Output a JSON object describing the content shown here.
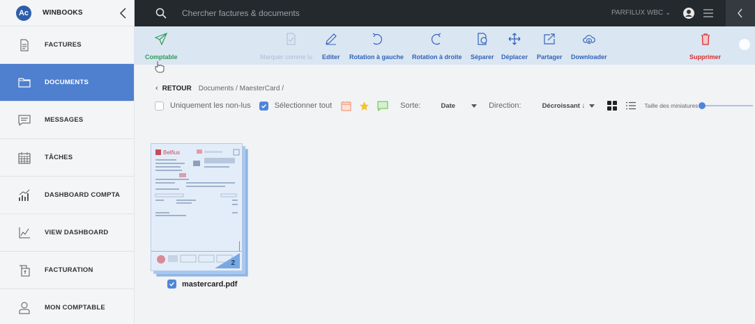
{
  "app": {
    "logo_text": "Ac",
    "title": "WINBOOKS"
  },
  "sidebar": {
    "items": [
      {
        "label": "FACTURES",
        "icon": "invoice-icon"
      },
      {
        "label": "DOCUMENTS",
        "icon": "folder-icon",
        "active": true
      },
      {
        "label": "MESSAGES",
        "icon": "message-icon"
      },
      {
        "label": "TÂCHES",
        "icon": "calendar-icon"
      },
      {
        "label": "DASHBOARD COMPTA",
        "icon": "chart-icon"
      },
      {
        "label": "VIEW DASHBOARD",
        "icon": "line-chart-icon"
      },
      {
        "label": "FACTURATION",
        "icon": "billing-icon"
      },
      {
        "label": "MON COMPTABLE",
        "icon": "user-icon"
      }
    ]
  },
  "topbar": {
    "search_placeholder": "Chercher factures & documents",
    "user_label": "PARFILUX WBC"
  },
  "toolbar": {
    "comptable": "Comptable",
    "marquer": "Marquer comme lu",
    "editer": "Editer",
    "rot_gauche": "Rotation à gauche",
    "rot_droite": "Rotation à droite",
    "separer": "Séparer",
    "deplacer": "Déplacer",
    "partager": "Partager",
    "downloader": "Downloader",
    "supprimer": "Supprimer"
  },
  "breadcrumb": {
    "back": "RETOUR",
    "path": "Documents / MaesterCard /"
  },
  "filters": {
    "non_lus": "Uniquement les non-lus",
    "select_all": "Sélectionner tout",
    "sort_label": "Sorte:",
    "sort_value": "Date",
    "direction_label": "Direction:",
    "direction_value": "Décroissant ↓",
    "thumb_size_label": "Taille des miniatures"
  },
  "document": {
    "file_name": "mastercard.pdf",
    "page_count": "2",
    "brand": "Belfius"
  },
  "colors": {
    "accent": "#4f7fcf",
    "topbar": "#24292d",
    "toolbar": "#dbe6f3",
    "green": "#2e9d57",
    "red": "#d62d2d"
  }
}
